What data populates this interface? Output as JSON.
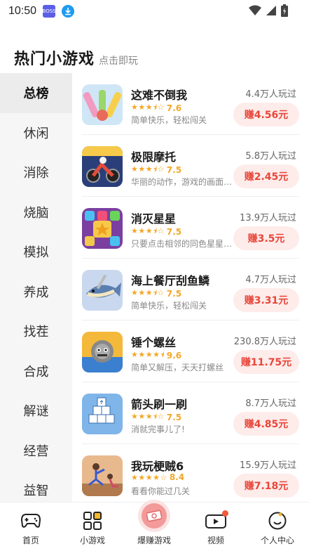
{
  "status": {
    "time": "10:50",
    "app_icon_text": "BOSS"
  },
  "header": {
    "title": "热门小游戏",
    "subtitle": "点击即玩"
  },
  "sidebar": {
    "items": [
      {
        "label": "总榜",
        "active": true
      },
      {
        "label": "休闲"
      },
      {
        "label": "消除"
      },
      {
        "label": "烧脑"
      },
      {
        "label": "模拟"
      },
      {
        "label": "养成"
      },
      {
        "label": "找茬"
      },
      {
        "label": "合成"
      },
      {
        "label": "解谜"
      },
      {
        "label": "经营"
      },
      {
        "label": "益智"
      }
    ]
  },
  "games": [
    {
      "name": "这难不倒我",
      "rating": "7.6",
      "stars": 3.5,
      "desc": "简单快乐，轻松闯关",
      "plays": "4.4万人玩过",
      "earn": "赚4.56元",
      "thumb_color": "#cfe6f7"
    },
    {
      "name": "极限摩托",
      "rating": "7.5",
      "stars": 3.5,
      "desc": "华丽的动作，游戏的画面…",
      "plays": "5.8万人玩过",
      "earn": "赚2.45元",
      "thumb_color": "#2a3f7a"
    },
    {
      "name": "消灭星星",
      "rating": "7.5",
      "stars": 3.5,
      "desc": "只要点击相邻的同色星星…",
      "plays": "13.9万人玩过",
      "earn": "赚3.5元",
      "thumb_color": "#7b3fa0"
    },
    {
      "name": "海上餐厅刮鱼鳞",
      "rating": "7.5",
      "stars": 3.5,
      "desc": "简单快乐，轻松闯关",
      "plays": "4.7万人玩过",
      "earn": "赚3.31元",
      "thumb_color": "#c9d8ee"
    },
    {
      "name": "锤个螺丝",
      "rating": "9.6",
      "stars": 4.5,
      "desc": "简单又解压，天天打螺丝",
      "plays": "230.8万人玩过",
      "earn": "赚11.75元",
      "thumb_color": "#f4b83a"
    },
    {
      "name": "箭头刷一刷",
      "rating": "7.5",
      "stars": 3.5,
      "desc": "消就完事儿了!",
      "plays": "8.7万人玩过",
      "earn": "赚4.85元",
      "thumb_color": "#7fb5e8"
    },
    {
      "name": "我玩梗贼6",
      "rating": "8.4",
      "stars": 4,
      "desc": "看看你能过几关",
      "plays": "15.9万人玩过",
      "earn": "赚7.18元",
      "thumb_color": "#e9b98e"
    }
  ],
  "nav": {
    "items": [
      {
        "label": "首页",
        "icon": "gamepad-icon"
      },
      {
        "label": "小游戏",
        "icon": "grid-icon"
      },
      {
        "label": "爆赚游戏",
        "icon": "money-icon"
      },
      {
        "label": "视频",
        "icon": "video-icon"
      },
      {
        "label": "个人中心",
        "icon": "smile-icon"
      }
    ]
  },
  "colors": {
    "accent": "#e8463a",
    "star": "#f5a623",
    "earn_bg": "#fdecea"
  }
}
